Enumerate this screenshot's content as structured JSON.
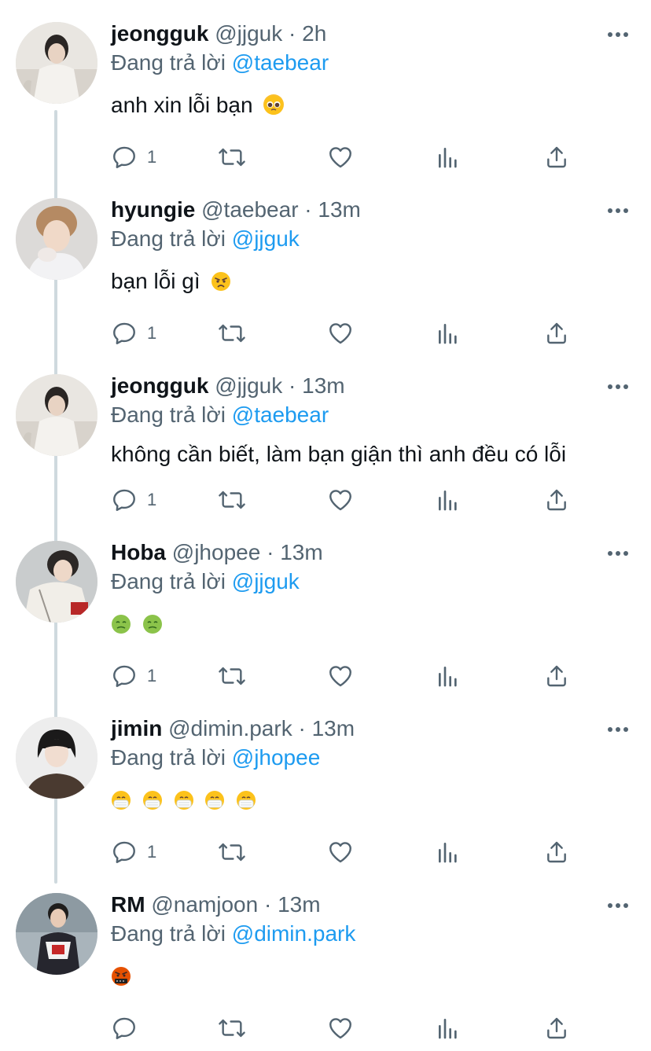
{
  "reply_prefix": "Đang trả lời",
  "colors": {
    "accent": "#1d9bf0",
    "muted": "#536471",
    "text": "#0f1419",
    "thread_line": "#cfd9de"
  },
  "tweets": [
    {
      "name": "jeongguk",
      "handle": "@jjguk",
      "dot": "·",
      "time": "2h",
      "reply_to": "@taebear",
      "text": "anh xin lỗi bạn",
      "emojis": [
        "pleading-face"
      ],
      "reply_count": "1"
    },
    {
      "name": "hyungie",
      "handle": "@taebear",
      "dot": "·",
      "time": "13m",
      "reply_to": "@jjguk",
      "text": "bạn lỗi gì",
      "emojis": [
        "angry-face"
      ],
      "reply_count": "1"
    },
    {
      "name": "jeongguk",
      "handle": "@jjguk",
      "dot": "·",
      "time": "13m",
      "reply_to": "@taebear",
      "text": "không cần biết, làm bạn giận thì anh đều có lỗi",
      "emojis": [],
      "reply_count": "1"
    },
    {
      "name": "Hoba",
      "handle": "@jhopee",
      "dot": "·",
      "time": "13m",
      "reply_to": "@jjguk",
      "text": "",
      "emojis": [
        "nauseated-face",
        "nauseated-face"
      ],
      "reply_count": "1"
    },
    {
      "name": "jimin",
      "handle": "@dimin.park",
      "dot": "·",
      "time": "13m",
      "reply_to": "@jhopee",
      "text": "",
      "emojis": [
        "mask-face",
        "mask-face",
        "mask-face",
        "mask-face",
        "mask-face"
      ],
      "reply_count": "1"
    },
    {
      "name": "RM",
      "handle": "@namjoon",
      "dot": "·",
      "time": "13m",
      "reply_to": "@dimin.park",
      "text": "",
      "emojis": [
        "cursing-face"
      ],
      "reply_count": ""
    }
  ]
}
